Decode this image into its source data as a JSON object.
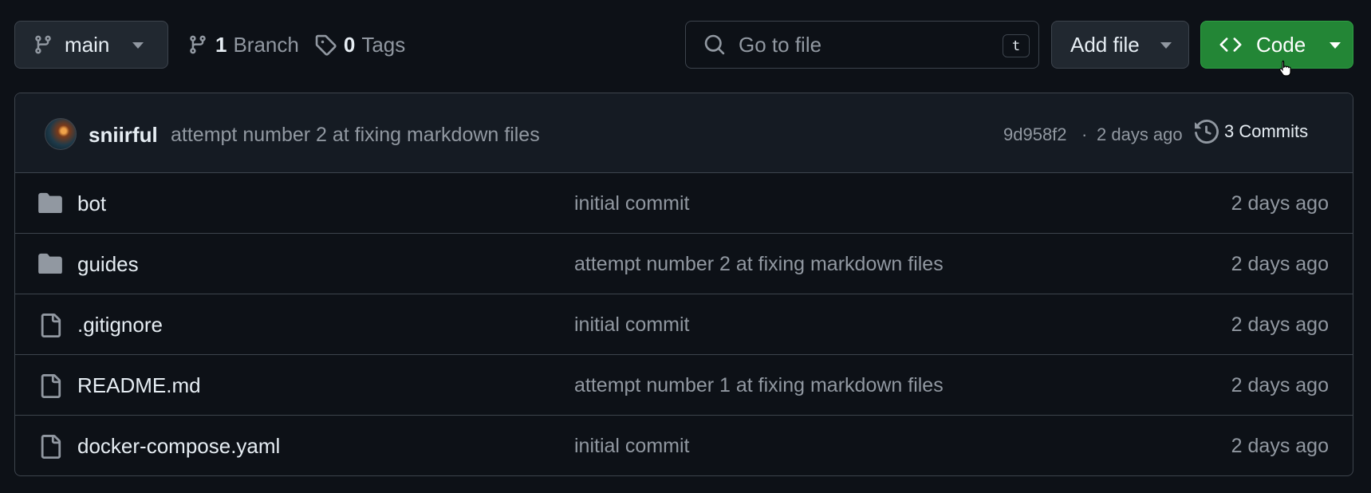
{
  "toolbar": {
    "branch": {
      "label": "main",
      "icon": "git-branch-icon"
    },
    "branches": {
      "count": "1",
      "label": "Branch",
      "icon": "git-branch-icon"
    },
    "tags": {
      "count": "0",
      "label": "Tags",
      "icon": "tag-icon"
    },
    "search": {
      "placeholder": "Go to file",
      "value": "",
      "shortcut": "t"
    },
    "add_file": {
      "label": "Add file"
    },
    "code": {
      "label": "Code",
      "color": "#238636"
    }
  },
  "latest_commit": {
    "author": "sniirful",
    "message": "attempt number 2 at fixing markdown files",
    "hash": "9d958f2",
    "separator": "·",
    "date": "2 days ago",
    "commits_label": "3 Commits"
  },
  "files": [
    {
      "type": "folder",
      "name": "bot",
      "message": "initial commit",
      "date": "2 days ago"
    },
    {
      "type": "folder",
      "name": "guides",
      "message": "attempt number 2 at fixing markdown files",
      "date": "2 days ago"
    },
    {
      "type": "file",
      "name": ".gitignore",
      "message": "initial commit",
      "date": "2 days ago"
    },
    {
      "type": "file",
      "name": "README.md",
      "message": "attempt number 1 at fixing markdown files",
      "date": "2 days ago"
    },
    {
      "type": "file",
      "name": "docker-compose.yaml",
      "message": "initial commit",
      "date": "2 days ago"
    }
  ],
  "colors": {
    "background": "#0d1117",
    "border": "#3d444d",
    "muted_text": "#9198a1",
    "primary_button": "#238636"
  }
}
